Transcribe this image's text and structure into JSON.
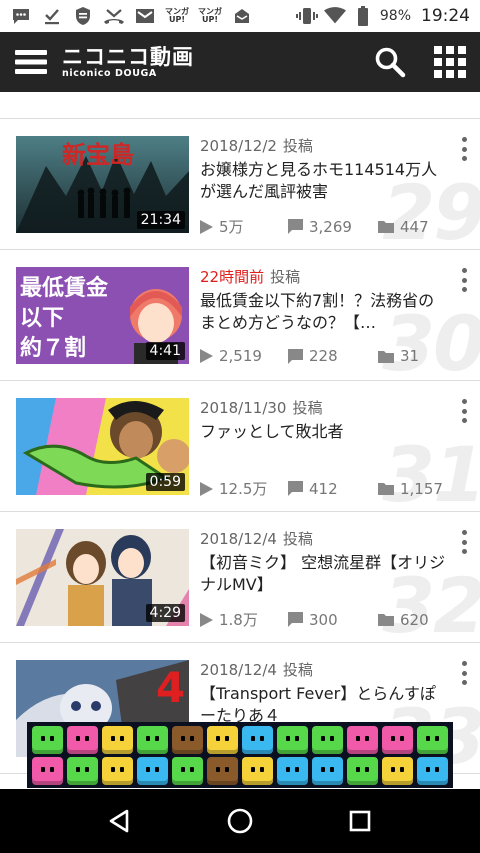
{
  "status_bar": {
    "battery": "98%",
    "time": "19:24",
    "manga_label": "マンガ\nUP!"
  },
  "app": {
    "logo_main": "ニコニコ動画",
    "logo_sub": "niconico DOUGA"
  },
  "videos": [
    {
      "date": "2018/12/2",
      "post_label": "投稿",
      "title": "お嬢様方と見るホモ114514万人が選んだ風評被害",
      "duration": "21:34",
      "views": "5万",
      "comments": "3,269",
      "mylists": "447",
      "rank": "29",
      "date_is_new": false,
      "thumb_text": "新宝島"
    },
    {
      "date": "22時間前",
      "post_label": "投稿",
      "title": "最低賃金以下約7割！？法務省のまとめ方どうなの？【…",
      "duration": "4:41",
      "views": "2,519",
      "comments": "228",
      "mylists": "31",
      "rank": "30",
      "date_is_new": true,
      "thumb_text": "最低賃金以下約７割"
    },
    {
      "date": "2018/11/30",
      "post_label": "投稿",
      "title": "ファッとして敗北者",
      "duration": "0:59",
      "views": "12.5万",
      "comments": "412",
      "mylists": "1,157",
      "rank": "31",
      "date_is_new": false,
      "thumb_text": ""
    },
    {
      "date": "2018/12/4",
      "post_label": "投稿",
      "title": "【初音ミク】 空想流星群【オリジナルMV】",
      "duration": "4:29",
      "views": "1.8万",
      "comments": "300",
      "mylists": "620",
      "rank": "32",
      "date_is_new": false,
      "thumb_text": ""
    },
    {
      "date": "2018/12/4",
      "post_label": "投稿",
      "title": "【Transport Fever】とらんすぽーたりあ４",
      "duration": "",
      "views": "",
      "comments": "",
      "mylists": "",
      "rank": "33",
      "date_is_new": false,
      "thumb_text": "4"
    }
  ],
  "icons": {
    "menu": "hamburger-icon",
    "search": "search-icon",
    "apps": "grid-icon",
    "views": "play-icon",
    "comments": "comment-icon",
    "mylists": "folder-icon",
    "nav_back": "back-triangle-icon",
    "nav_home": "home-circle-icon",
    "nav_recents": "recents-square-icon"
  },
  "colors": {
    "appbar": "#252525",
    "new_date": "#e0201c",
    "rank_watermark": "#eeeeee"
  }
}
